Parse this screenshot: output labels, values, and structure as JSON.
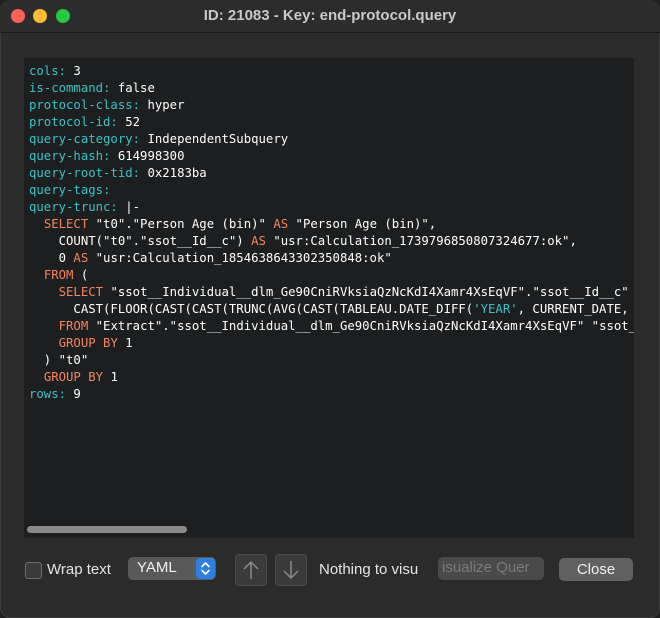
{
  "window": {
    "title": "ID: 21083 - Key: end-protocol.query"
  },
  "editor": {
    "lines": [
      [
        {
          "t": "cols:",
          "c": "k"
        },
        {
          "t": " 3",
          "c": "fn"
        }
      ],
      [
        {
          "t": "is-command:",
          "c": "k"
        },
        {
          "t": " false",
          "c": "fn"
        }
      ],
      [
        {
          "t": "protocol-class:",
          "c": "k"
        },
        {
          "t": " hyper",
          "c": "fn"
        }
      ],
      [
        {
          "t": "protocol-id:",
          "c": "k"
        },
        {
          "t": " 52",
          "c": "fn"
        }
      ],
      [
        {
          "t": "query-category:",
          "c": "k"
        },
        {
          "t": " IndependentSubquery",
          "c": "fn"
        }
      ],
      [
        {
          "t": "query-hash:",
          "c": "k"
        },
        {
          "t": " 614998300",
          "c": "fn"
        }
      ],
      [
        {
          "t": "query-root-tid:",
          "c": "k"
        },
        {
          "t": " 0x2183ba",
          "c": "fn"
        }
      ],
      [
        {
          "t": "query-tags:",
          "c": "k"
        }
      ],
      [
        {
          "t": "query-trunc:",
          "c": "k"
        },
        {
          "t": " |-",
          "c": "fn"
        }
      ],
      [
        {
          "t": "  ",
          "c": "fn"
        },
        {
          "t": "SELECT",
          "c": "kw"
        },
        {
          "t": " \"t0\".\"Person Age (bin)\" ",
          "c": "fn"
        },
        {
          "t": "AS",
          "c": "kw"
        },
        {
          "t": " \"Person Age (bin)\",",
          "c": "fn"
        }
      ],
      [
        {
          "t": "    COUNT(\"t0\".\"ssot__Id__c\") ",
          "c": "fn"
        },
        {
          "t": "AS",
          "c": "kw"
        },
        {
          "t": " \"usr:Calculation_1739796850807324677:ok\",",
          "c": "fn"
        }
      ],
      [
        {
          "t": "    0 ",
          "c": "fn"
        },
        {
          "t": "AS",
          "c": "kw"
        },
        {
          "t": " \"usr:Calculation_1854638643302350848:ok\"",
          "c": "fn"
        }
      ],
      [
        {
          "t": "  ",
          "c": "fn"
        },
        {
          "t": "FROM",
          "c": "kw"
        },
        {
          "t": " (",
          "c": "fn"
        }
      ],
      [
        {
          "t": "    ",
          "c": "fn"
        },
        {
          "t": "SELECT",
          "c": "kw"
        },
        {
          "t": " \"ssot__Individual__dlm_Ge90CniRVksiaQzNcKdI4Xamr4XsEqVF\".\"ssot__Id__c\" ",
          "c": "fn"
        },
        {
          "t": "AS",
          "c": "kw"
        }
      ],
      [
        {
          "t": "      CAST(FLOOR(CAST(CAST(TRUNC(AVG(CAST(TABLEAU.DATE_DIFF(",
          "c": "fn"
        },
        {
          "t": "'YEAR'",
          "c": "str"
        },
        {
          "t": ", CURRENT_DATE, \"s",
          "c": "fn"
        }
      ],
      [
        {
          "t": "    ",
          "c": "fn"
        },
        {
          "t": "FROM",
          "c": "kw"
        },
        {
          "t": " \"Extract\".\"ssot__Individual__dlm_Ge90CniRVksiaQzNcKdI4Xamr4XsEqVF\" \"ssot__I",
          "c": "fn"
        }
      ],
      [
        {
          "t": "    ",
          "c": "fn"
        },
        {
          "t": "GROUP BY",
          "c": "kw"
        },
        {
          "t": " 1",
          "c": "fn"
        }
      ],
      [
        {
          "t": "  ) \"t0\"",
          "c": "fn"
        }
      ],
      [
        {
          "t": "  ",
          "c": "fn"
        },
        {
          "t": "GROUP BY",
          "c": "kw"
        },
        {
          "t": " 1",
          "c": "fn"
        }
      ],
      [
        {
          "t": "rows:",
          "c": "k"
        },
        {
          "t": " 9",
          "c": "fn"
        }
      ]
    ]
  },
  "footer": {
    "wrap_label": "Wrap text",
    "wrap_checked": false,
    "format_value": "YAML",
    "up_icon": "arrow-up-icon",
    "down_icon": "arrow-down-icon",
    "status_text": "Nothing to visu",
    "visualize_label": "isualize Quer",
    "close_label": "Close"
  }
}
